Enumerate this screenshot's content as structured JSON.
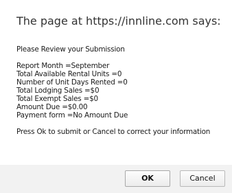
{
  "dialog": {
    "title": "The page at https://innline.com says:",
    "heading": "Please Review your Submission",
    "details": [
      "Report Month =September",
      "Total Available Rental Units =0",
      "Number of Unit Days Rented =0",
      "Total Lodging Sales =$0",
      "Total Exempt Sales =$0",
      "Amount Due =$0.00",
      "Payment form =No Amount Due"
    ],
    "prompt": "Press Ok to submit or Cancel to correct your information",
    "ok_label": "OK",
    "cancel_label": "Cancel"
  }
}
